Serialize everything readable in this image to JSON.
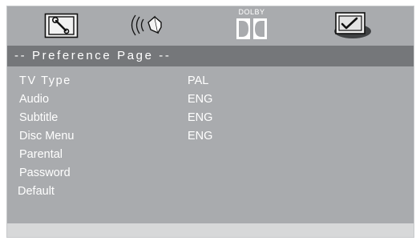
{
  "tabs": [
    {
      "icon": "general-setup-icon"
    },
    {
      "icon": "audio-speaker-icon"
    },
    {
      "icon": "dolby-digital-icon",
      "text": "DOLBY"
    },
    {
      "icon": "preference-check-icon"
    }
  ],
  "page_title": "-- Preference Page --",
  "menu": {
    "items": [
      {
        "label": "TV Type",
        "value": "PAL"
      },
      {
        "label": "Audio",
        "value": "ENG"
      },
      {
        "label": "Subtitle",
        "value": "ENG"
      },
      {
        "label": "Disc Menu",
        "value": "ENG"
      },
      {
        "label": "Parental",
        "value": ""
      },
      {
        "label": "Password",
        "value": ""
      },
      {
        "label": "Default",
        "value": ""
      }
    ]
  },
  "colors": {
    "panel": "#a9abae",
    "title_bar": "#75777a",
    "text": "#ffffff",
    "footer": "#d7d8d9"
  }
}
